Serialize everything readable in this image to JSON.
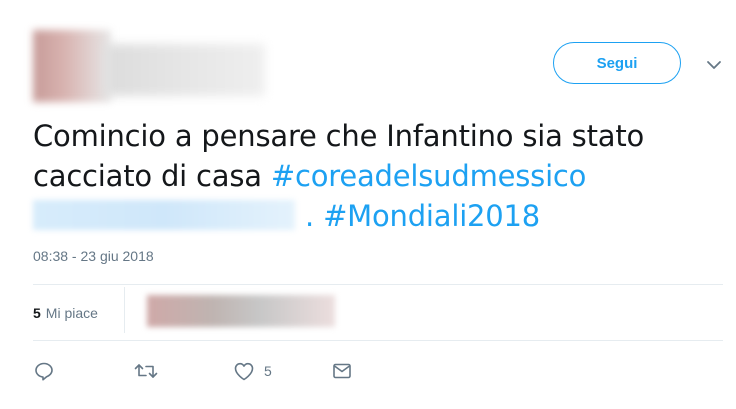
{
  "tweet": {
    "follow_label": "Segui",
    "text_line1": "Comincio a pensare che Infantino sia stato",
    "text_line2_prefix": "cacciato di casa ",
    "hashtag1": "#coreadelsudmessico",
    "text_line3_sep": ".",
    "hashtag2": "#Mondiali2018",
    "timestamp": "08:38 - 23 giu 2018"
  },
  "stats": {
    "likes_count": "5",
    "likes_label": "Mi piace"
  },
  "actions": {
    "like_count": "5"
  },
  "icons": {
    "reply": "reply-icon",
    "retweet": "retweet-icon",
    "like": "heart-icon",
    "message": "message-icon",
    "menu": "chevron-down-icon"
  },
  "colors": {
    "accent": "#1da1f2",
    "text": "#14171a",
    "muted": "#657786",
    "border": "#e6ecf0"
  }
}
